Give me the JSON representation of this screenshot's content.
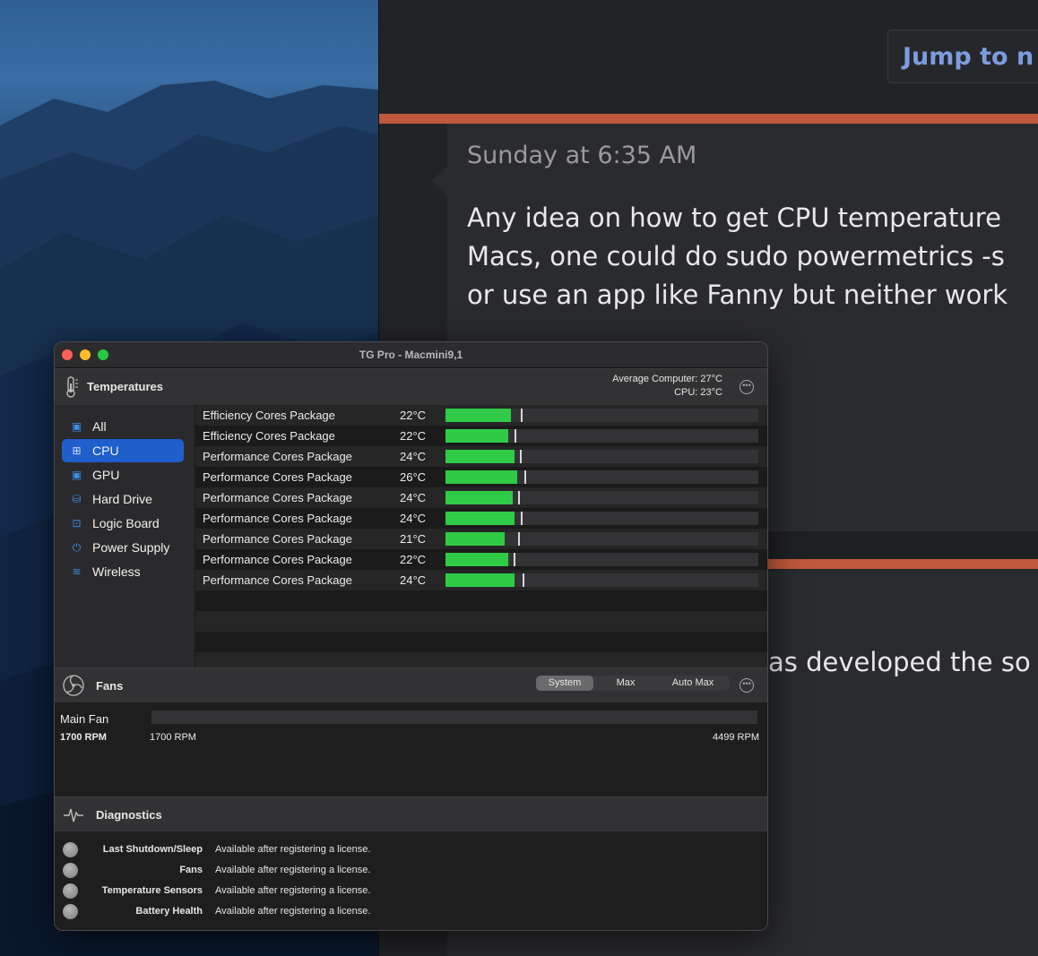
{
  "forum": {
    "jump_button": "Jump to n",
    "post_time": "Sunday at 6:35 AM",
    "post_lines": [
      "Any idea on how to get CPU temperature",
      "Macs, one could do sudo powermetrics -s",
      "or use an app like Fanny but neither work"
    ],
    "post2_fragment": "as developed the so"
  },
  "window": {
    "title": "TG Pro - Macmini9,1"
  },
  "temperatures": {
    "title": "Temperatures",
    "average_label": "Average Computer:",
    "average_value": "27°C",
    "cpu_label": "CPU:",
    "cpu_value": "23°C",
    "more_icon": "ellipsis-circle-icon",
    "fill_color": "#2fcb46",
    "sidebar": [
      {
        "label": "All",
        "icon": "all-chip-icon"
      },
      {
        "label": "CPU",
        "icon": "cpu-icon",
        "active": true
      },
      {
        "label": "GPU",
        "icon": "gpu-icon"
      },
      {
        "label": "Hard Drive",
        "icon": "hard-drive-icon"
      },
      {
        "label": "Logic Board",
        "icon": "logic-board-icon"
      },
      {
        "label": "Power Supply",
        "icon": "power-icon"
      },
      {
        "label": "Wireless",
        "icon": "wifi-icon"
      }
    ],
    "rows": [
      {
        "name": "Efficiency Cores Package",
        "value": "22°C",
        "level": 0.21,
        "max_level": 0.23
      },
      {
        "name": "Efficiency Cores Package",
        "value": "22°C",
        "level": 0.2,
        "max_level": 0.21
      },
      {
        "name": "Performance Cores Package",
        "value": "24°C",
        "level": 0.22,
        "max_level": 0.225
      },
      {
        "name": "Performance Cores Package",
        "value": "26°C",
        "level": 0.23,
        "max_level": 0.24
      },
      {
        "name": "Performance Cores Package",
        "value": "24°C",
        "level": 0.215,
        "max_level": 0.22
      },
      {
        "name": "Performance Cores Package",
        "value": "24°C",
        "level": 0.22,
        "max_level": 0.23
      },
      {
        "name": "Performance Cores Package",
        "value": "21°C",
        "level": 0.19,
        "max_level": 0.22
      },
      {
        "name": "Performance Cores Package",
        "value": "22°C",
        "level": 0.2,
        "max_level": 0.205
      },
      {
        "name": "Performance Cores Package",
        "value": "24°C",
        "level": 0.22,
        "max_level": 0.235
      }
    ]
  },
  "fans": {
    "title": "Fans",
    "modes": [
      "System",
      "Max",
      "Auto Max"
    ],
    "active_mode": "System",
    "fan_name": "Main Fan",
    "current": "1700 RPM",
    "min": "1700 RPM",
    "max": "4499 RPM"
  },
  "diagnostics": {
    "title": "Diagnostics",
    "items": [
      {
        "label": "Last Shutdown/Sleep",
        "value": "Available after registering a license."
      },
      {
        "label": "Fans",
        "value": "Available after registering a license."
      },
      {
        "label": "Temperature Sensors",
        "value": "Available after registering a license."
      },
      {
        "label": "Battery Health",
        "value": "Available after registering a license."
      }
    ]
  }
}
